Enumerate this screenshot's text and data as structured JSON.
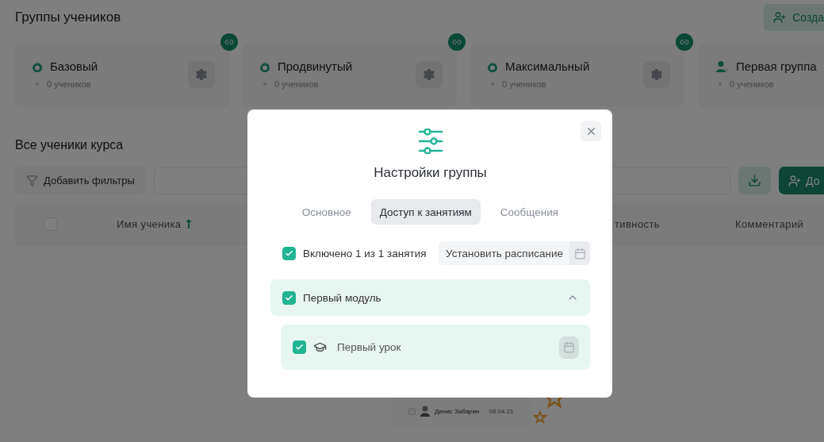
{
  "page": {
    "title": "Группы учеников",
    "create_button": "Созда"
  },
  "groups": [
    {
      "name": "Базовый",
      "kind": "flame",
      "count": "0 учеников",
      "linked": true,
      "settings": true
    },
    {
      "name": "Продвинутый",
      "kind": "flame",
      "count": "0 учеников",
      "linked": true,
      "settings": true
    },
    {
      "name": "Максимальный",
      "kind": "flame",
      "count": "0 учеников",
      "linked": true,
      "settings": true
    },
    {
      "name": "Первая группа",
      "kind": "person",
      "count": "0 учеников",
      "linked": false,
      "settings": false
    }
  ],
  "students": {
    "title": "Все ученики курса",
    "filter_button": "Добавить фильтры",
    "add_button": "До",
    "select_all_checked": false,
    "columns": [
      {
        "label": "Имя ученика",
        "sorted": true
      },
      {
        "label": "тивность",
        "sorted": false
      },
      {
        "label": "Комментарий",
        "sorted": false
      }
    ]
  },
  "empty_illustration": {
    "name": "Денис Забарин",
    "date": "08.04.21",
    "checked": false
  },
  "modal": {
    "title": "Настройки группы",
    "tabs": [
      {
        "label": "Основное",
        "selected": false
      },
      {
        "label": "Доступ к занятиям",
        "selected": true
      },
      {
        "label": "Сообщения",
        "selected": false
      }
    ],
    "summary": {
      "label": "Включено 1 из 1 занятия",
      "checked": true
    },
    "schedule_button": "Установить расписание",
    "modules": [
      {
        "title": "Первый модуль",
        "checked": true,
        "expanded": true,
        "lessons": [
          {
            "title": "Первый урок",
            "checked": true
          }
        ]
      }
    ]
  }
}
